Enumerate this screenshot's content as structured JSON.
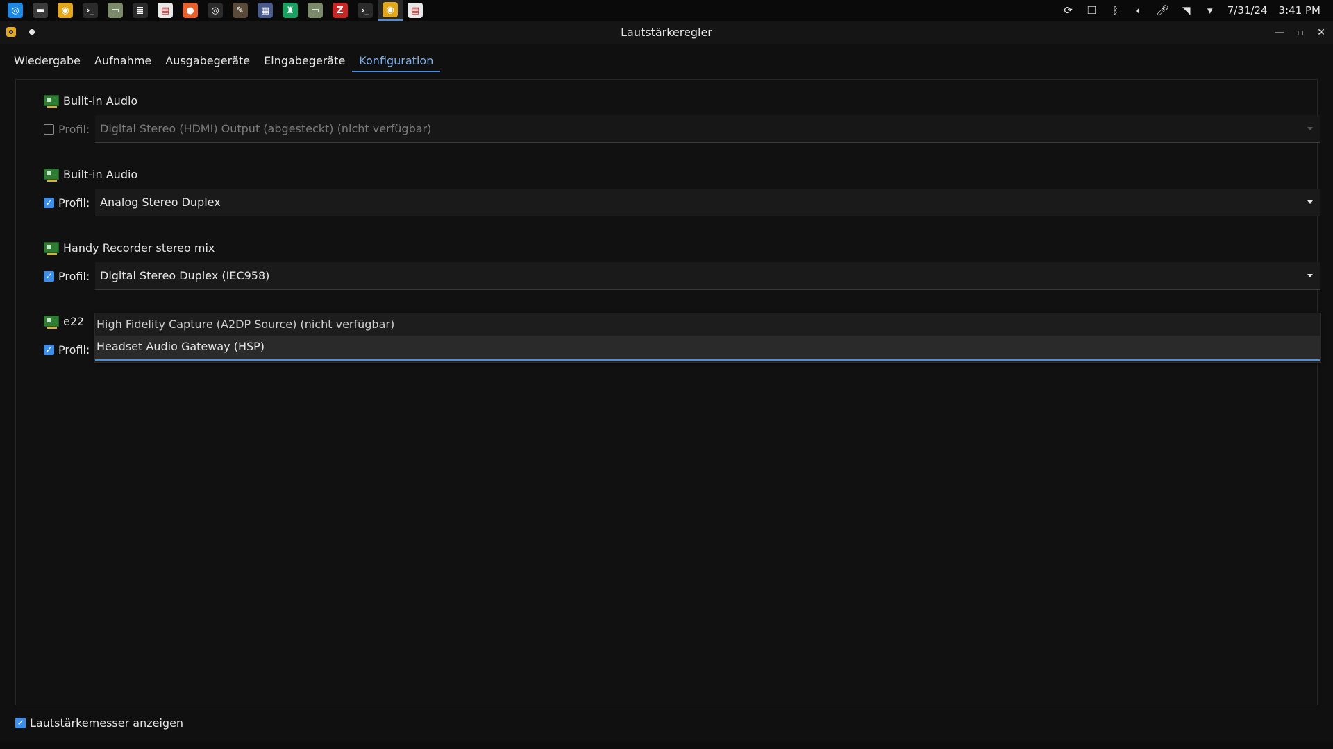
{
  "taskbar": {
    "launchers": [
      {
        "icon": "app-launcher-icon",
        "color": "#1e88e5",
        "glyph": "◎"
      },
      {
        "icon": "files-icon",
        "color": "#3a3a3a",
        "glyph": "▬"
      },
      {
        "icon": "volume-control-icon",
        "color": "#e2a81d",
        "glyph": "◉"
      },
      {
        "icon": "terminal-icon",
        "color": "#2b2b2b",
        "glyph": "›_"
      },
      {
        "icon": "file-manager-icon",
        "color": "#7a8a6a",
        "glyph": "▭"
      },
      {
        "icon": "archive-icon",
        "color": "#2b2b2b",
        "glyph": "≣"
      },
      {
        "icon": "document-viewer-icon",
        "color": "#e8e8e8",
        "glyph": "▤"
      },
      {
        "icon": "firefox-icon",
        "color": "#e8602c",
        "glyph": "●"
      },
      {
        "icon": "camera-icon",
        "color": "#2b2b2b",
        "glyph": "◎"
      },
      {
        "icon": "gimp-icon",
        "color": "#5a4a3a",
        "glyph": "✎"
      },
      {
        "icon": "app-grid-icon",
        "color": "#4a5a8a",
        "glyph": "▦"
      },
      {
        "icon": "software-center-icon",
        "color": "#1aa060",
        "glyph": "♜"
      },
      {
        "icon": "files-2-icon",
        "color": "#7a8a6a",
        "glyph": "▭"
      },
      {
        "icon": "filezilla-icon",
        "color": "#c62828",
        "glyph": "Z"
      },
      {
        "icon": "terminal-2-icon",
        "color": "#2b2b2b",
        "glyph": "›_"
      },
      {
        "icon": "volume-control-active-icon",
        "color": "#e2a81d",
        "glyph": "◉"
      },
      {
        "icon": "document-viewer-2-icon",
        "color": "#e8e8e8",
        "glyph": "▤"
      }
    ],
    "tray_icons": [
      "update-icon",
      "clipboard-icon",
      "bluetooth-icon",
      "speaker-icon",
      "microphone-icon",
      "wifi-icon",
      "caret-down-icon"
    ],
    "date": "7/31/24",
    "time": "3:41 PM"
  },
  "window": {
    "title": "Lautstärkeregler"
  },
  "tabs": [
    {
      "label": "Wiedergabe",
      "active": false
    },
    {
      "label": "Aufnahme",
      "active": false
    },
    {
      "label": "Ausgabegeräte",
      "active": false
    },
    {
      "label": "Eingabegeräte",
      "active": false
    },
    {
      "label": "Konfiguration",
      "active": true
    }
  ],
  "cards": [
    {
      "name": "Built-in Audio",
      "profile_label": "Profil:",
      "enabled": false,
      "profile": "Digital Stereo (HDMI) Output (abgesteckt) (nicht verfügbar)"
    },
    {
      "name": "Built-in Audio",
      "profile_label": "Profil:",
      "enabled": true,
      "profile": "Analog Stereo Duplex"
    },
    {
      "name": "Handy Recorder stereo mix",
      "profile_label": "Profil:",
      "enabled": true,
      "profile": "Digital Stereo Duplex (IEC958)"
    },
    {
      "name": "e22",
      "profile_label": "Profil:",
      "enabled": true,
      "profile": "Headset Audio Gateway (HSP)"
    }
  ],
  "dropdown_options": [
    "High Fidelity Capture (A2DP Source) (nicht verfügbar)",
    "Headset Audio Gateway (HSP)"
  ],
  "footer": {
    "show_meters_label": "Lautstärkemesser anzeigen",
    "show_meters_checked": true
  }
}
